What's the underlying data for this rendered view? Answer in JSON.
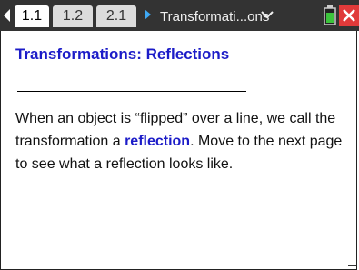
{
  "tabs": [
    {
      "label": "1.1",
      "active": true
    },
    {
      "label": "1.2",
      "active": false
    },
    {
      "label": "2.1",
      "active": false
    }
  ],
  "document_title": "Transformati...ons",
  "page": {
    "heading": "Transformations: Reflections",
    "body_before": "When an object is “flipped” over a line, we call the transformation a ",
    "keyword": "reflection",
    "body_after": ". Move to the next page to see what a reflection looks like."
  },
  "colors": {
    "heading": "#1c1cc8",
    "close": "#e03a3a",
    "battery": "#3cc43c"
  }
}
